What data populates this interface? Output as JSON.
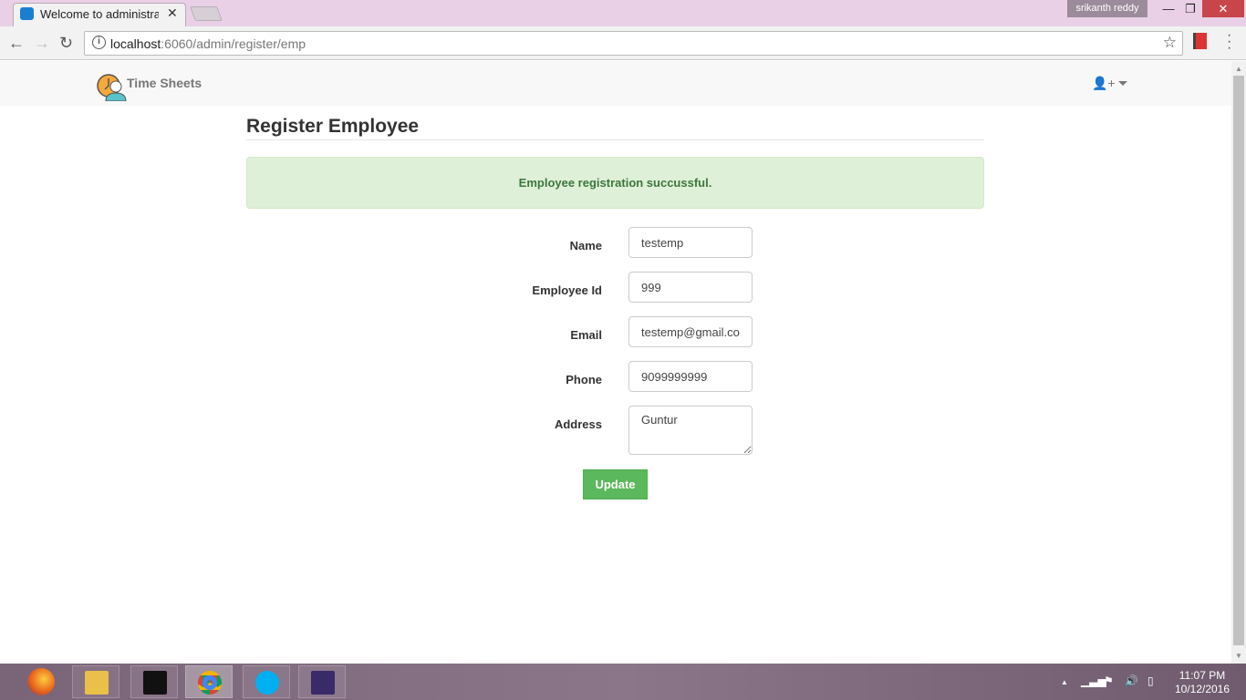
{
  "browser": {
    "tab_title": "Welcome to administratio",
    "url_host": "localhost",
    "url_path": ":6060/admin/register/emp",
    "user": "srikanth reddy"
  },
  "navbar": {
    "brand": "Time Sheets",
    "user_menu_icon": "user-plus-icon"
  },
  "page": {
    "title": "Register Employee",
    "alert": "Employee registration succussful.",
    "fields": [
      {
        "label": "Name",
        "value": "testemp"
      },
      {
        "label": "Employee Id",
        "value": "999"
      },
      {
        "label": "Email",
        "value": "testemp@gmail.com"
      },
      {
        "label": "Phone",
        "value": "9099999999"
      },
      {
        "label": "Address",
        "value": "Guntur"
      }
    ],
    "submit": "Update"
  },
  "taskbar": {
    "apps": [
      "firefox",
      "file-explorer",
      "audio-editor",
      "chrome",
      "skype",
      "java-ee-ide"
    ],
    "time": "11:07 PM",
    "date": "10/12/2016"
  },
  "colors": {
    "success": "#5cb85c",
    "alert_bg": "#dff0d8",
    "alert_text": "#3c763d"
  }
}
